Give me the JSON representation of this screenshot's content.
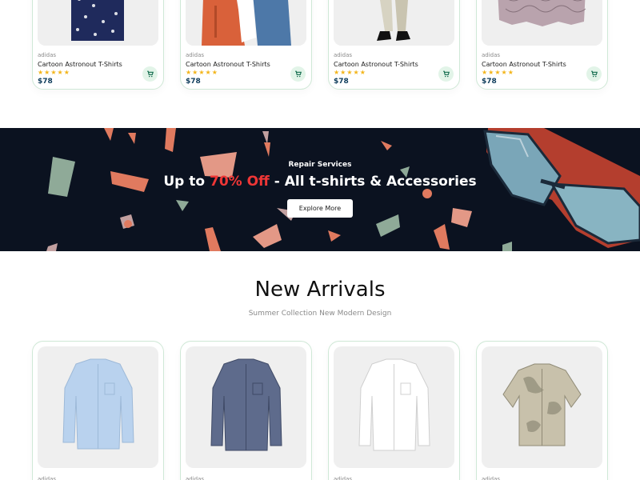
{
  "colors": {
    "accent": "#ef3636",
    "banner_bg": "#0b1220",
    "price": "#0f3d5c",
    "stars": "#f3b51b",
    "cart_bg": "#e2f4e8",
    "card_border": "#cfe8d6"
  },
  "top_products": [
    {
      "brand": "adidas",
      "title": "Cartoon Astronout T-Shirts",
      "rating": "★★★★★",
      "price": "$78"
    },
    {
      "brand": "adidas",
      "title": "Cartoon Astronout T-Shirts",
      "rating": "★★★★★",
      "price": "$78"
    },
    {
      "brand": "adidas",
      "title": "Cartoon Astronout T-Shirts",
      "rating": "★★★★★",
      "price": "$78"
    },
    {
      "brand": "adidas",
      "title": "Cartoon Astronout T-Shirts",
      "rating": "★★★★★",
      "price": "$78"
    }
  ],
  "banner": {
    "kicker": "Repair Services",
    "title_prefix": "Up to ",
    "title_accent": "70% Off",
    "title_suffix": " - All t-shirts & Accessories",
    "button_label": "Explore More"
  },
  "new_arrivals": {
    "title": "New Arrivals",
    "subtitle": "Summer Collection New Modern Design",
    "products": [
      {
        "brand": "adidas"
      },
      {
        "brand": "adidas"
      },
      {
        "brand": "adidas"
      },
      {
        "brand": "adidas"
      }
    ]
  },
  "icons": {
    "cart": "cart-icon"
  }
}
